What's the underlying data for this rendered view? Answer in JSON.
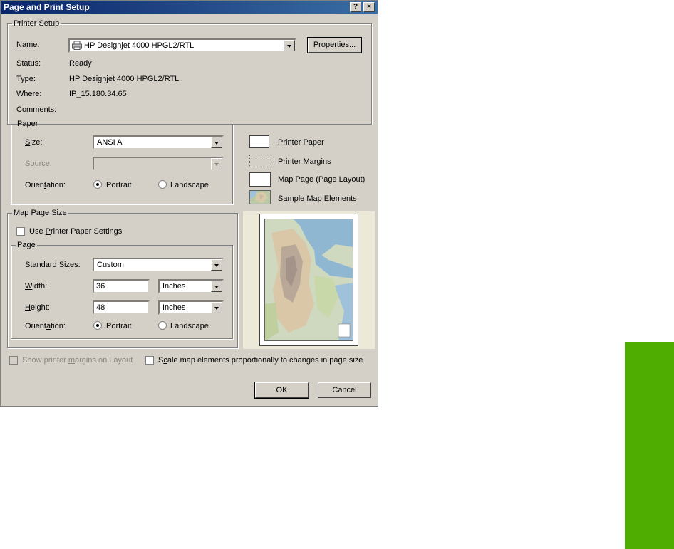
{
  "window": {
    "title": "Page and Print Setup",
    "help_button": "?",
    "close_button": "×"
  },
  "printer_setup": {
    "group_label": "Printer Setup",
    "name_label": "Name:",
    "name_value": "HP Designjet 4000 HPGL2/RTL",
    "properties_button": "Properties...",
    "status_label": "Status:",
    "status_value": "Ready",
    "type_label": "Type:",
    "type_value": "HP Designjet 4000 HPGL2/RTL",
    "where_label": "Where:",
    "where_value": "IP_15.180.34.65",
    "comments_label": "Comments:"
  },
  "paper": {
    "group_label": "Paper",
    "size_label": "Size:",
    "size_value": "ANSI A",
    "source_label": "Source:",
    "source_value": "",
    "orientation_label": "Orientation:",
    "portrait_label": "Portrait",
    "landscape_label": "Landscape",
    "orientation_selected": "Portrait"
  },
  "legend": {
    "printer_paper": "Printer Paper",
    "printer_margins": "Printer Margins",
    "map_page": "Map Page (Page Layout)",
    "sample_elements": "Sample Map Elements"
  },
  "map_page_size": {
    "group_label": "Map Page Size",
    "use_printer_settings_label": "Use Printer Paper Settings",
    "use_printer_settings_checked": false,
    "page_group_label": "Page",
    "standard_sizes_label": "Standard Sizes:",
    "standard_sizes_value": "Custom",
    "width_label": "Width:",
    "width_value": "36",
    "width_unit": "Inches",
    "height_label": "Height:",
    "height_value": "48",
    "height_unit": "Inches",
    "orientation_label": "Orientation:",
    "portrait_label": "Portrait",
    "landscape_label": "Landscape",
    "orientation_selected": "Portrait"
  },
  "footer": {
    "show_margins_label": "Show printer margins on Layout",
    "show_margins_checked": false,
    "scale_elements_label": "Scale map elements proportionally to changes in page size",
    "scale_elements_checked": false,
    "ok_button": "OK",
    "cancel_button": "Cancel"
  },
  "colors": {
    "dialog_bg": "#d4d0c8",
    "titlebar_start": "#0a246a",
    "titlebar_end": "#3a6ea5",
    "side_tab": "#4ead00"
  }
}
